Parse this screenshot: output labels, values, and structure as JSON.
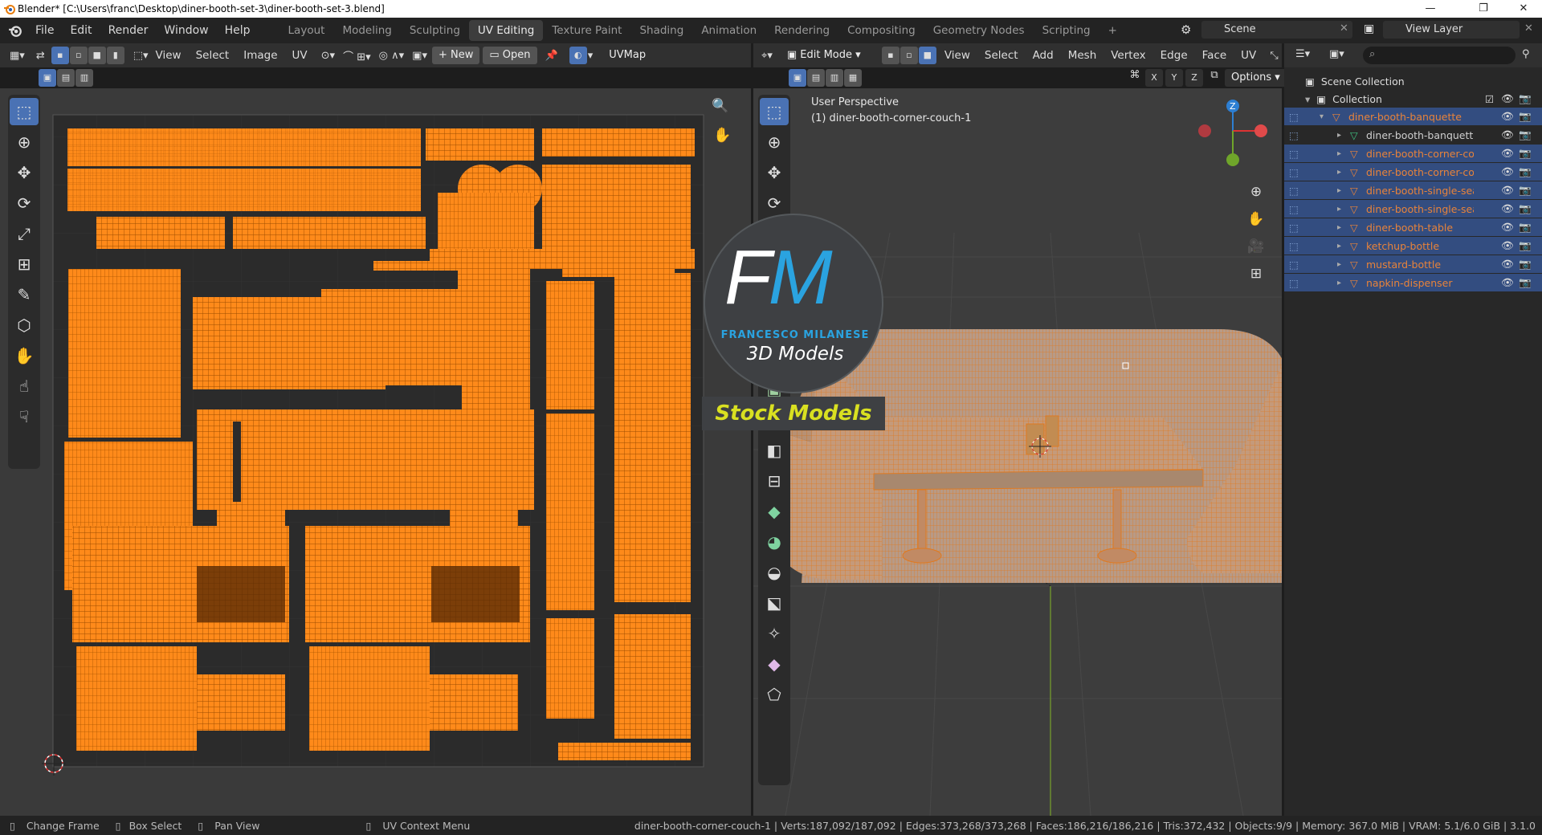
{
  "window": {
    "title": "Blender* [C:\\Users\\franc\\Desktop\\diner-booth-set-3\\diner-booth-set-3.blend]",
    "min": "—",
    "max": "❐",
    "close": "✕"
  },
  "menus": [
    "File",
    "Edit",
    "Render",
    "Window",
    "Help"
  ],
  "workspaces": [
    "Layout",
    "Modeling",
    "Sculpting",
    "UV Editing",
    "Texture Paint",
    "Shading",
    "Animation",
    "Rendering",
    "Compositing",
    "Geometry Nodes",
    "Scripting",
    "+"
  ],
  "active_workspace": "UV Editing",
  "scene": {
    "label": "Scene",
    "view_layer": "View Layer"
  },
  "uv_header": {
    "view": "View",
    "select": "Select",
    "image": "Image",
    "uv": "UV",
    "new": "New",
    "open": "Open",
    "uvmap": "UVMap"
  },
  "vp_header": {
    "mode": "Edit Mode",
    "view": "View",
    "select": "Select",
    "add": "Add",
    "mesh": "Mesh",
    "vertex": "Vertex",
    "edge": "Edge",
    "face": "Face",
    "uv": "UV",
    "x": "X",
    "y": "Y",
    "z": "Z",
    "options": "Options"
  },
  "viewport": {
    "perspective": "User Perspective",
    "object": "(1) diner-booth-corner-couch-1",
    "gizmo_z": "Z"
  },
  "watermark": {
    "letters_f": "F",
    "letters_m": "M",
    "brand": "FRANCESCO MILANESE",
    "sub": "3D Models",
    "banner": "Stock Models"
  },
  "outliner": {
    "scene_collection": "Scene Collection",
    "collection": "Collection",
    "items": [
      {
        "name": "diner-booth-banquette",
        "level": 1,
        "type": "mesh",
        "hl": true
      },
      {
        "name": "diner-booth-banquette",
        "level": 2,
        "type": "data",
        "hl": false
      },
      {
        "name": "diner-booth-corner-co",
        "level": 2,
        "type": "mesh",
        "hl": true
      },
      {
        "name": "diner-booth-corner-co",
        "level": 2,
        "type": "mesh",
        "hl": true
      },
      {
        "name": "diner-booth-single-sea",
        "level": 2,
        "type": "mesh",
        "hl": true
      },
      {
        "name": "diner-booth-single-sea",
        "level": 2,
        "type": "mesh",
        "hl": true
      },
      {
        "name": "diner-booth-table",
        "level": 2,
        "type": "mesh",
        "hl": true
      },
      {
        "name": "ketchup-bottle",
        "level": 2,
        "type": "mesh",
        "hl": true
      },
      {
        "name": "mustard-bottle",
        "level": 2,
        "type": "mesh",
        "hl": true
      },
      {
        "name": "napkin-dispenser",
        "level": 2,
        "type": "mesh",
        "hl": true
      }
    ]
  },
  "status": {
    "change_frame": "Change Frame",
    "box_select": "Box Select",
    "pan_view": "Pan View",
    "uv_context": "UV Context Menu",
    "stats": "diner-booth-corner-couch-1 | Verts:187,092/187,092 | Edges:373,268/373,268 | Faces:186,216/186,216 | Tris:372,432 | Objects:9/9 | Memory: 367.0 MiB | VRAM: 5.1/6.0 GiB | 3.1.0"
  },
  "colors": {
    "accent": "#4a72b4",
    "uv_orange": "#ff8a1a",
    "selected_text": "#e8833a"
  }
}
